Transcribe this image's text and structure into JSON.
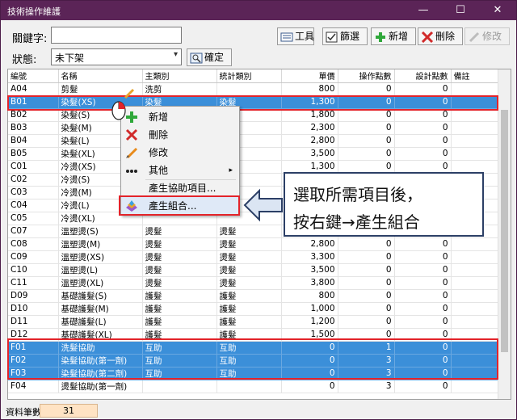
{
  "window": {
    "title": "技術操作維護",
    "minimize": "—",
    "maximize": "☐",
    "close": "✕"
  },
  "search": {
    "keyword_label": "關鍵字:",
    "keyword_value": "",
    "status_label": "狀態:",
    "status_value": "未下架",
    "confirm_label": "確定"
  },
  "toolbar": {
    "tools": "工具",
    "filter": "篩選",
    "add": "新增",
    "delete": "刪除",
    "modify": "修改"
  },
  "grid": {
    "columns": [
      "編號",
      "名稱",
      "主類別",
      "統計類別",
      "單價",
      "操作點數",
      "設計點數",
      "備註"
    ],
    "rows": [
      {
        "code": "A04",
        "name": "剪髮",
        "main": "洗剪",
        "stat": "",
        "price": "800",
        "op": "0",
        "design": "0",
        "note": ""
      },
      {
        "code": "B01",
        "name": "染髮(XS)",
        "main": "染髮",
        "stat": "染髮",
        "price": "1,300",
        "op": "0",
        "design": "0",
        "note": ""
      },
      {
        "code": "B02",
        "name": "染髮(S)",
        "main": "",
        "stat": "",
        "price": "1,800",
        "op": "0",
        "design": "0",
        "note": ""
      },
      {
        "code": "B03",
        "name": "染髮(M)",
        "main": "",
        "stat": "",
        "price": "2,300",
        "op": "0",
        "design": "0",
        "note": ""
      },
      {
        "code": "B04",
        "name": "染髮(L)",
        "main": "",
        "stat": "",
        "price": "2,800",
        "op": "0",
        "design": "0",
        "note": ""
      },
      {
        "code": "B05",
        "name": "染髮(XL)",
        "main": "",
        "stat": "",
        "price": "3,500",
        "op": "0",
        "design": "0",
        "note": ""
      },
      {
        "code": "C01",
        "name": "冷燙(XS)",
        "main": "",
        "stat": "",
        "price": "1,300",
        "op": "0",
        "design": "0",
        "note": ""
      },
      {
        "code": "C02",
        "name": "冷燙(S)",
        "main": "",
        "stat": "",
        "price": "",
        "op": "",
        "design": "",
        "note": ""
      },
      {
        "code": "C03",
        "name": "冷燙(M)",
        "main": "",
        "stat": "",
        "price": "",
        "op": "",
        "design": "",
        "note": ""
      },
      {
        "code": "C04",
        "name": "冷燙(L)",
        "main": "",
        "stat": "",
        "price": "",
        "op": "",
        "design": "",
        "note": ""
      },
      {
        "code": "C05",
        "name": "冷燙(XL)",
        "main": "",
        "stat": "",
        "price": "",
        "op": "",
        "design": "",
        "note": ""
      },
      {
        "code": "C07",
        "name": "溫塑燙(S)",
        "main": "燙髮",
        "stat": "燙髮",
        "price": "",
        "op": "",
        "design": "",
        "note": ""
      },
      {
        "code": "C08",
        "name": "溫塑燙(M)",
        "main": "燙髮",
        "stat": "燙髮",
        "price": "2,800",
        "op": "0",
        "design": "0",
        "note": ""
      },
      {
        "code": "C09",
        "name": "溫塑燙(XS)",
        "main": "燙髮",
        "stat": "燙髮",
        "price": "3,300",
        "op": "0",
        "design": "0",
        "note": ""
      },
      {
        "code": "C10",
        "name": "溫塑燙(L)",
        "main": "燙髮",
        "stat": "燙髮",
        "price": "3,500",
        "op": "0",
        "design": "0",
        "note": ""
      },
      {
        "code": "C11",
        "name": "溫塑燙(XL)",
        "main": "燙髮",
        "stat": "燙髮",
        "price": "3,800",
        "op": "0",
        "design": "0",
        "note": ""
      },
      {
        "code": "D09",
        "name": "基礎護髮(S)",
        "main": "護髮",
        "stat": "護髮",
        "price": "800",
        "op": "0",
        "design": "0",
        "note": ""
      },
      {
        "code": "D10",
        "name": "基礎護髮(M)",
        "main": "護髮",
        "stat": "護髮",
        "price": "1,000",
        "op": "0",
        "design": "0",
        "note": ""
      },
      {
        "code": "D11",
        "name": "基礎護髮(L)",
        "main": "護髮",
        "stat": "護髮",
        "price": "1,200",
        "op": "0",
        "design": "0",
        "note": ""
      },
      {
        "code": "D12",
        "name": "基礎護髮(XL)",
        "main": "護髮",
        "stat": "護髮",
        "price": "1,500",
        "op": "0",
        "design": "0",
        "note": ""
      },
      {
        "code": "F01",
        "name": "洗髮協助",
        "main": "互助",
        "stat": "互助",
        "price": "0",
        "op": "1",
        "design": "0",
        "note": ""
      },
      {
        "code": "F02",
        "name": "染髮協助(第一劑)",
        "main": "互助",
        "stat": "互助",
        "price": "0",
        "op": "3",
        "design": "0",
        "note": ""
      },
      {
        "code": "F03",
        "name": "染髮協助(第二劑)",
        "main": "互助",
        "stat": "互助",
        "price": "0",
        "op": "3",
        "design": "0",
        "note": ""
      },
      {
        "code": "F04",
        "name": "燙髮協助(第一劑)",
        "main": "",
        "stat": "",
        "price": "0",
        "op": "3",
        "design": "0",
        "note": ""
      }
    ],
    "selected_rows": [
      1,
      20,
      21,
      22
    ]
  },
  "context_menu": {
    "items": [
      {
        "label": "新增",
        "icon": "plus-icon"
      },
      {
        "label": "刪除",
        "icon": "x-icon"
      },
      {
        "label": "修改",
        "icon": "pencil-icon"
      },
      {
        "label": "其他",
        "icon": "dots-icon",
        "submenu_arrow": "▸"
      },
      {
        "label": "產生協助項目...",
        "icon": ""
      },
      {
        "label": "產生組合...",
        "icon": "combine-icon"
      }
    ]
  },
  "callout": {
    "line1": "選取所需項目後，",
    "line2": "按右鍵→產生組合"
  },
  "status": {
    "count_label": "資料筆數:",
    "count_value": "31"
  },
  "colors": {
    "title_bar": "#5b2457",
    "selection": "#3b8fd9",
    "highlight_border": "#e3232a",
    "callout_border": "#2c3f66",
    "status_value_bg": "#ffe3c4"
  }
}
